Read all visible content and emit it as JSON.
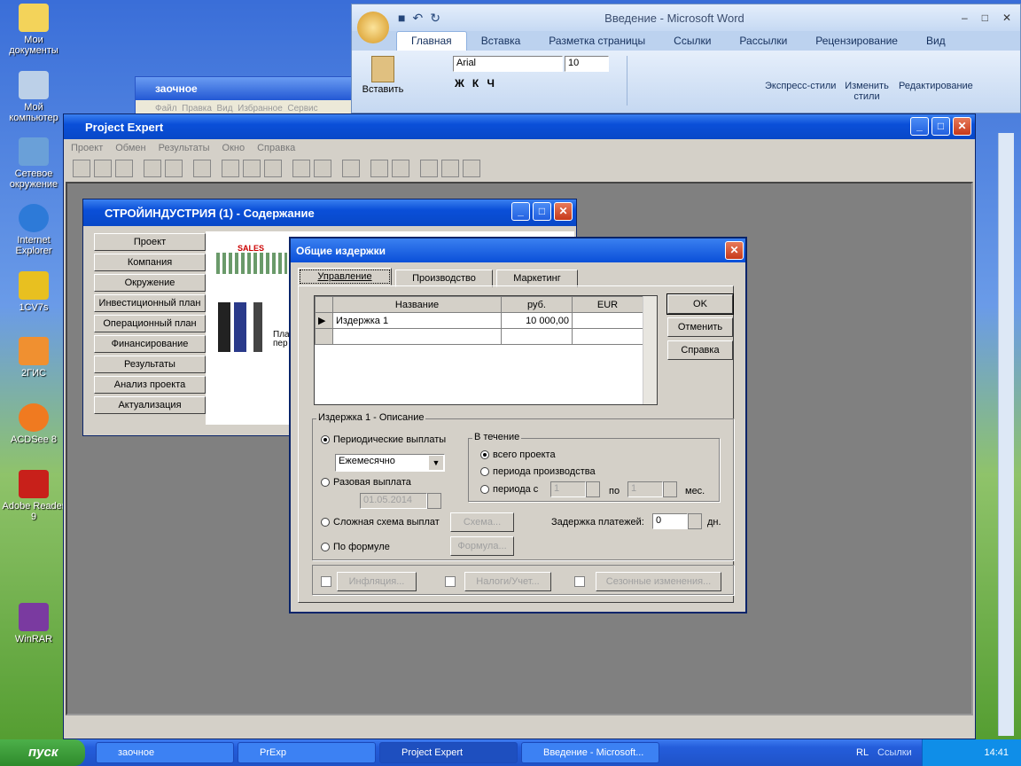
{
  "desktop": {
    "icons": [
      "Мои документы",
      "Мой компьютер",
      "Сетевое окружение",
      "Internet Explorer",
      "1CV7s",
      "2ГИС",
      "ACDSee 8",
      "Adobe Reader 9",
      "WinRAR"
    ]
  },
  "word": {
    "title": "Введение - Microsoft Word",
    "tabs": [
      "Главная",
      "Вставка",
      "Разметка страницы",
      "Ссылки",
      "Рассылки",
      "Рецензирование",
      "Вид"
    ],
    "font": "Arial",
    "size": "10",
    "paste": "Вставить",
    "styles": "Экспресс-стили",
    "change_styles": "Изменить стили",
    "editing": "Редактирование"
  },
  "explorer": {
    "title": "заочное",
    "menu": "Файл  Правка  Вид  Избранное  Сервис"
  },
  "pe": {
    "title": "Project Expert",
    "menu": [
      "Проект",
      "Обмен",
      "Результаты",
      "Окно",
      "Справка"
    ]
  },
  "content": {
    "title": "СТРОЙИНДУСТРИЯ (1) - Содержание",
    "nav": [
      "Проект",
      "Компания",
      "Окружение",
      "Инвестиционный план",
      "Операционный план",
      "Финансирование",
      "Результаты",
      "Анализ проекта",
      "Актуализация"
    ],
    "sales": "SALES",
    "pic_text": "Пла пер"
  },
  "dialog": {
    "title": "Общие издержки",
    "tabs": [
      "Управление",
      "Производство",
      "Маркетинг"
    ],
    "buttons": {
      "ok": "OK",
      "cancel": "Отменить",
      "help": "Справка",
      "scheme": "Схема...",
      "formula": "Формула...",
      "inflation": "Инфляция...",
      "taxes": "Налоги/Учет...",
      "seasonal": "Сезонные изменения..."
    },
    "grid": {
      "headers": [
        "Название",
        "руб.",
        "EUR"
      ],
      "rows": [
        [
          "Издержка 1",
          "10 000,00",
          ""
        ]
      ]
    },
    "desc_label": "Издержка 1 - Описание",
    "periodic": "Периодические выплаты",
    "period_value": "Ежемесячно",
    "onetime": "Разовая выплата",
    "onetime_date": "01.05.2014",
    "complex": "Сложная схема выплат",
    "by_formula": "По формуле",
    "during": "В течение",
    "all_project": "всего проекта",
    "production": "периода производства",
    "period_from": "периода с",
    "from_value": "1",
    "to_label": "по",
    "to_value": "1",
    "months": "мес.",
    "delay_label": "Задержка платежей:",
    "delay_value": "0",
    "days": "дн."
  },
  "taskbar": {
    "start": "пуск",
    "tasks": [
      "заочное",
      "PrExp",
      "Project Expert",
      "Введение - Microsoft..."
    ],
    "lang": "RL",
    "links": "Ссылки",
    "time": "14:41"
  }
}
